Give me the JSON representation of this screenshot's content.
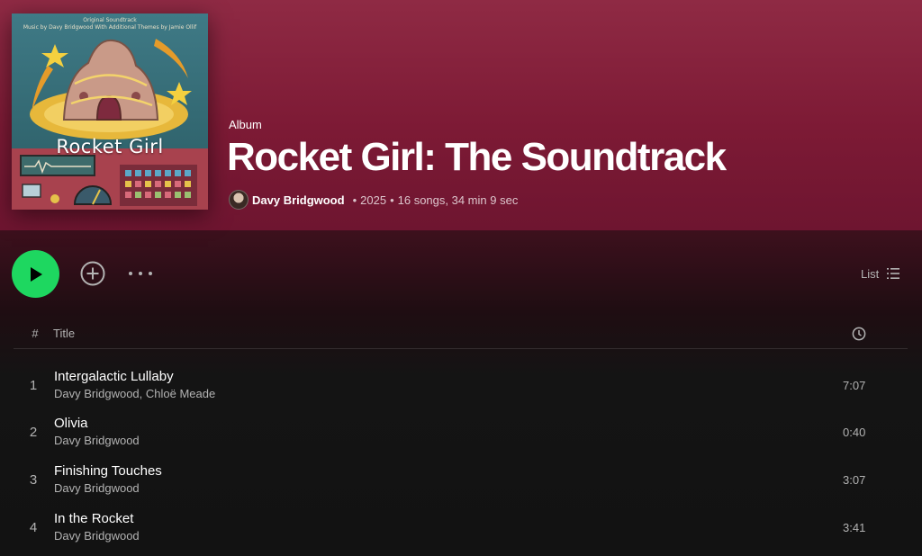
{
  "album": {
    "type_label": "Album",
    "title": "Rocket Girl: The Soundtrack",
    "artist": "Davy Bridgwood",
    "year": "2025",
    "stats": "16 songs, 34 min 9 sec",
    "cover": {
      "top_line_1": "Original Soundtrack",
      "top_line_2": "Music by Davy Bridgwood  With Additional Themes by Jamie Ollif",
      "title": "Rocket Girl"
    }
  },
  "controls": {
    "play_icon": "play-icon",
    "add_icon": "plus-circle-icon",
    "more_icon": "more-horizontal-icon",
    "view_label": "List",
    "view_icon": "list-icon"
  },
  "table_header": {
    "num": "#",
    "title": "Title",
    "duration_icon": "clock-icon"
  },
  "tracks": [
    {
      "num": "1",
      "name": "Intergalactic Lullaby",
      "artists": "Davy Bridgwood, Chloë Meade",
      "duration": "7:07"
    },
    {
      "num": "2",
      "name": "Olivia",
      "artists": "Davy Bridgwood",
      "duration": "0:40"
    },
    {
      "num": "3",
      "name": "Finishing Touches",
      "artists": "Davy Bridgwood",
      "duration": "3:07"
    },
    {
      "num": "4",
      "name": "In the Rocket",
      "artists": "Davy Bridgwood",
      "duration": "3:41"
    }
  ],
  "colors": {
    "accent_green": "#1ed760",
    "header_gradient_top": "#8f2a44",
    "header_gradient_bottom": "#6e1530",
    "background": "#121212"
  }
}
